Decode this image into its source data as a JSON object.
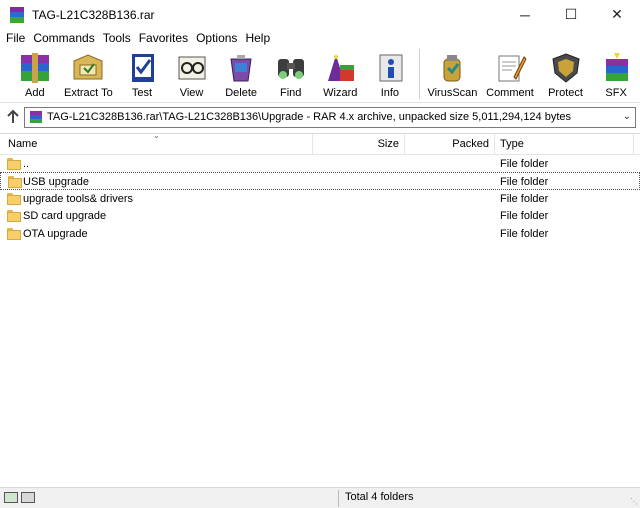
{
  "window": {
    "title": "TAG-L21C328B136.rar",
    "controls": {
      "minimize": "─",
      "maximize": "☐",
      "close": "✕"
    }
  },
  "menu": [
    "File",
    "Commands",
    "Tools",
    "Favorites",
    "Options",
    "Help"
  ],
  "toolbar": [
    {
      "label": "Add",
      "icon": "add-archive-icon"
    },
    {
      "label": "Extract To",
      "icon": "extract-icon"
    },
    {
      "label": "Test",
      "icon": "test-icon"
    },
    {
      "label": "View",
      "icon": "view-icon"
    },
    {
      "label": "Delete",
      "icon": "delete-icon"
    },
    {
      "label": "Find",
      "icon": "find-icon"
    },
    {
      "label": "Wizard",
      "icon": "wizard-icon"
    },
    {
      "label": "Info",
      "icon": "info-icon"
    },
    {
      "label": "VirusScan",
      "icon": "virusscan-icon"
    },
    {
      "label": "Comment",
      "icon": "comment-icon"
    },
    {
      "label": "Protect",
      "icon": "protect-icon"
    },
    {
      "label": "SFX",
      "icon": "sfx-icon"
    }
  ],
  "address": {
    "path": "TAG-L21C328B136.rar\\TAG-L21C328B136\\Upgrade - RAR 4.x archive, unpacked size 5,011,294,124 bytes"
  },
  "columns": {
    "name": "Name",
    "size": "Size",
    "packed": "Packed",
    "type": "Type"
  },
  "files": [
    {
      "name": "..",
      "size": "",
      "packed": "",
      "type": "File folder"
    },
    {
      "name": "USB upgrade",
      "size": "",
      "packed": "",
      "type": "File folder",
      "selected": true
    },
    {
      "name": "upgrade tools& drivers",
      "size": "",
      "packed": "",
      "type": "File folder"
    },
    {
      "name": "SD card upgrade",
      "size": "",
      "packed": "",
      "type": "File folder"
    },
    {
      "name": "OTA upgrade",
      "size": "",
      "packed": "",
      "type": "File folder"
    }
  ],
  "status": {
    "text": "Total 4 folders"
  },
  "colors": {
    "folder": "#f6cf6a",
    "border": "#7a7a7a"
  }
}
